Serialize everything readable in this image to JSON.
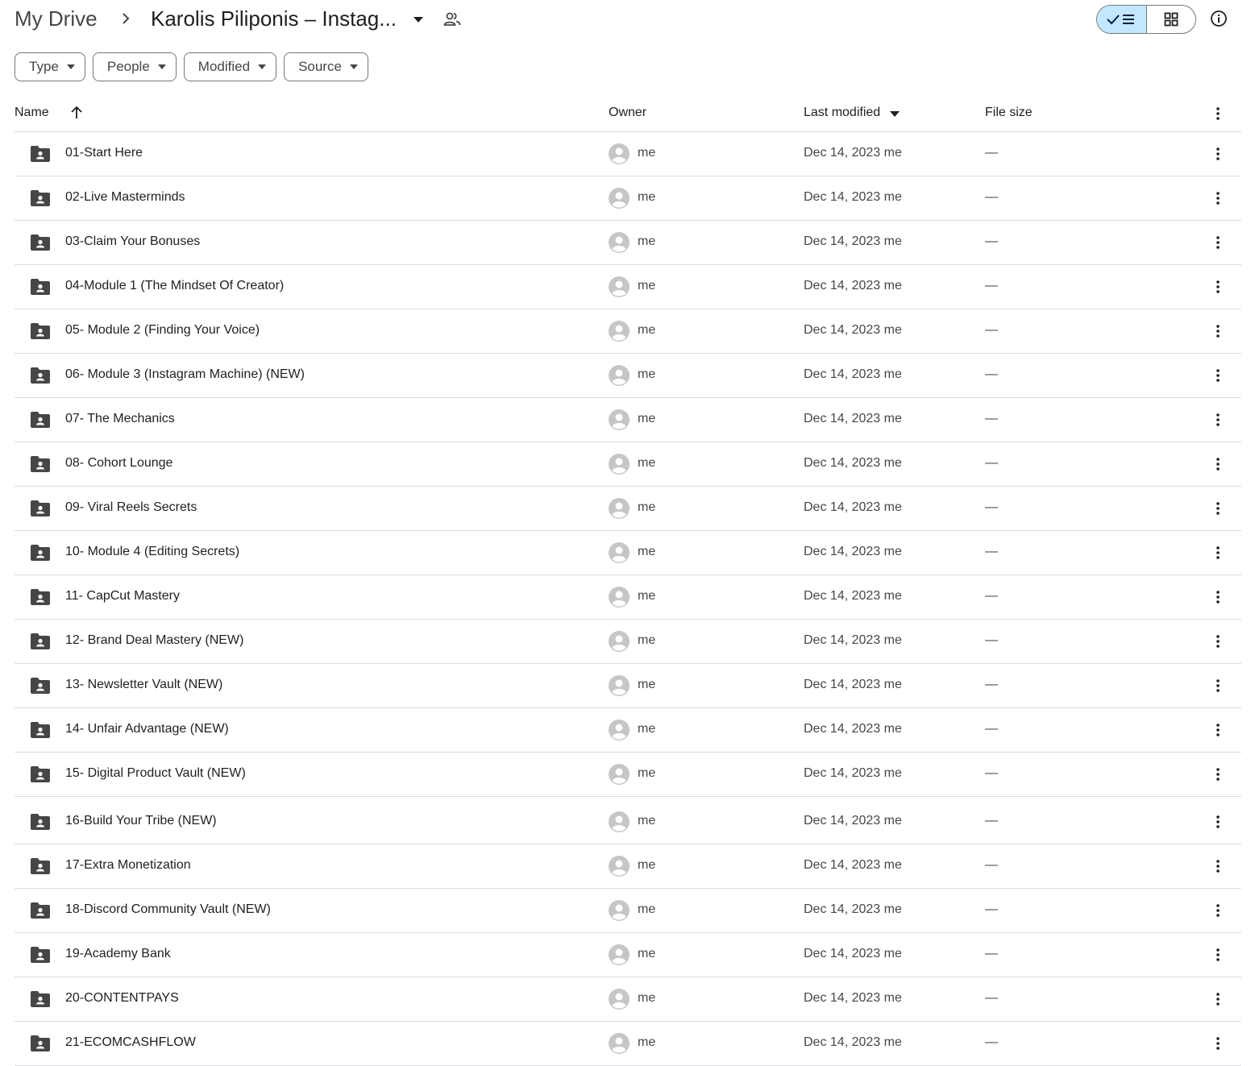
{
  "breadcrumb": {
    "root": "My Drive",
    "separator": "›",
    "current": "Karolis Piliponis – Instag..."
  },
  "icons": {
    "separator": "chevron-right-icon",
    "caret": "arrow-drop-down-icon",
    "shared": "people-icon",
    "list_view": "check-list-icon",
    "grid_view": "grid-icon",
    "info": "info-icon",
    "folder": "shared-folder-icon",
    "avatar": "account-circle-icon",
    "more": "more-vert-icon",
    "sort": "arrow-upward-icon"
  },
  "filters": [
    {
      "label": "Type"
    },
    {
      "label": "People"
    },
    {
      "label": "Modified"
    },
    {
      "label": "Source"
    }
  ],
  "columns": {
    "name": "Name",
    "owner": "Owner",
    "last_modified": "Last modified",
    "file_size": "File size"
  },
  "rows": [
    {
      "name": "01-Start Here",
      "owner": "me",
      "modified": "Dec 14, 2023 me",
      "size": "—"
    },
    {
      "name": "02-Live Masterminds",
      "owner": "me",
      "modified": "Dec 14, 2023 me",
      "size": "—"
    },
    {
      "name": "03-Claim Your Bonuses",
      "owner": "me",
      "modified": "Dec 14, 2023 me",
      "size": "—"
    },
    {
      "name": "04-Module 1 (The Mindset Of Creator)",
      "owner": "me",
      "modified": "Dec 14, 2023 me",
      "size": "—"
    },
    {
      "name": "05- Module 2 (Finding Your Voice)",
      "owner": "me",
      "modified": "Dec 14, 2023 me",
      "size": "—"
    },
    {
      "name": "06- Module 3 (Instagram Machine) (NEW)",
      "owner": "me",
      "modified": "Dec 14, 2023 me",
      "size": "—"
    },
    {
      "name": "07- The Mechanics",
      "owner": "me",
      "modified": "Dec 14, 2023 me",
      "size": "—"
    },
    {
      "name": "08- Cohort Lounge",
      "owner": "me",
      "modified": "Dec 14, 2023 me",
      "size": "—"
    },
    {
      "name": "09- Viral Reels Secrets",
      "owner": "me",
      "modified": "Dec 14, 2023 me",
      "size": "—"
    },
    {
      "name": "10- Module 4 (Editing Secrets)",
      "owner": "me",
      "modified": "Dec 14, 2023 me",
      "size": "—"
    },
    {
      "name": "11- CapCut Mastery",
      "owner": "me",
      "modified": "Dec 14, 2023 me",
      "size": "—"
    },
    {
      "name": "12- Brand Deal Mastery (NEW)",
      "owner": "me",
      "modified": "Dec 14, 2023 me",
      "size": "—"
    },
    {
      "name": "13- Newsletter Vault (NEW)",
      "owner": "me",
      "modified": "Dec 14, 2023 me",
      "size": "—"
    },
    {
      "name": "14- Unfair Advantage (NEW)",
      "owner": "me",
      "modified": "Dec 14, 2023 me",
      "size": "—"
    },
    {
      "name": "15- Digital Product Vault (NEW)",
      "owner": "me",
      "modified": "Dec 14, 2023 me",
      "size": "—"
    },
    {
      "name": "16-Build Your Tribe (NEW)",
      "owner": "me",
      "modified": "Dec 14, 2023 me",
      "size": "—"
    },
    {
      "name": "17-Extra Monetization",
      "owner": "me",
      "modified": "Dec 14, 2023 me",
      "size": "—"
    },
    {
      "name": "18-Discord Community Vault (NEW)",
      "owner": "me",
      "modified": "Dec 14, 2023 me",
      "size": "—"
    },
    {
      "name": "19-Academy Bank",
      "owner": "me",
      "modified": "Dec 14, 2023 me",
      "size": "—"
    },
    {
      "name": "20-CONTENTPAYS",
      "owner": "me",
      "modified": "Dec 14, 2023 me",
      "size": "—"
    },
    {
      "name": "21-ECOMCASHFLOW",
      "owner": "me",
      "modified": "Dec 14, 2023 me",
      "size": "—"
    }
  ],
  "colors": {
    "text": "#1f1f1f",
    "muted": "#444746",
    "active_toggle": "#c2e7ff",
    "divider": "#dadce0",
    "avatar": "#c4c7c5"
  }
}
